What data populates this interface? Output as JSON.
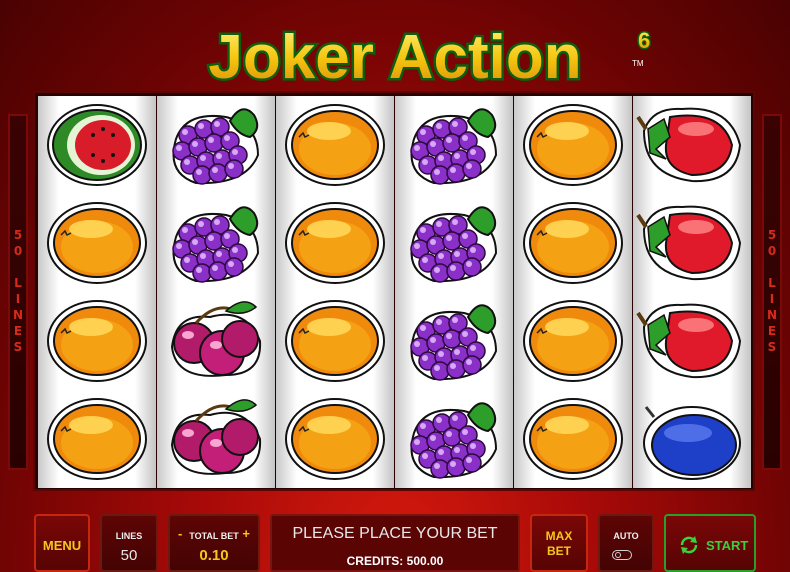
{
  "game": {
    "title": "Joker Action",
    "title_superscript": "6",
    "trademark": "TM"
  },
  "side_label": "50 LINES",
  "reels": [
    [
      "watermelon",
      "orange",
      "orange",
      "orange"
    ],
    [
      "grapes",
      "grapes",
      "cherries",
      "cherries"
    ],
    [
      "orange",
      "orange",
      "orange",
      "orange"
    ],
    [
      "grapes",
      "grapes",
      "grapes",
      "grapes"
    ],
    [
      "orange",
      "orange",
      "orange",
      "orange"
    ],
    [
      "strawberry",
      "strawberry",
      "strawberry",
      "plum"
    ]
  ],
  "controls": {
    "menu_label": "MENU",
    "lines_label": "LINES",
    "lines_value": "50",
    "total_bet_label": "TOTAL BET",
    "total_bet_value": "0.10",
    "bet_minus": "-",
    "bet_plus": "+",
    "message": "PLEASE PLACE YOUR BET",
    "credits_text": "CREDITS: 500.00",
    "max_bet_line1": "MAX",
    "max_bet_line2": "BET",
    "auto_label": "AUTO",
    "auto_enabled": false,
    "start_label": "START"
  },
  "colors": {
    "title_fill": "#f6c611",
    "title_outline": "#1f8a1f",
    "accent_yellow": "#f3c81b",
    "button_border": "#c4280f",
    "start_green": "#3ad23a",
    "background_red": "#a80a08"
  }
}
